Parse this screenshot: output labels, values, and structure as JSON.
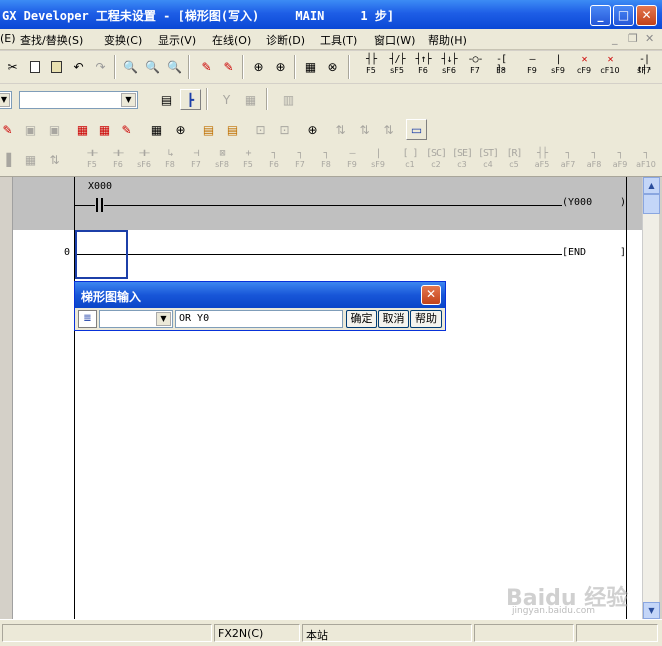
{
  "window": {
    "title": "GX Developer 工程未设置 - [梯形图(写入)     MAIN     1 步]",
    "minimize_glyph": "_",
    "maximize_glyph": "□",
    "close_glyph": "✕"
  },
  "menu": {
    "items": [
      "查找/替换(S)",
      "变换(C)",
      "显示(V)",
      "在线(O)",
      "诊断(D)",
      "工具(T)",
      "窗口(W)",
      "帮助(H)"
    ],
    "partial_first": "(E)",
    "mdi_min": "_",
    "mdi_restore": "❐",
    "mdi_close": "✕"
  },
  "fkeys_row1": [
    {
      "sym": "┤├",
      "label": "F5"
    },
    {
      "sym": "┤/├",
      "label": "sF5"
    },
    {
      "sym": "┤↑├",
      "label": "F6"
    },
    {
      "sym": "┤↓├",
      "label": "sF6"
    },
    {
      "sym": "-○-",
      "label": "F7"
    },
    {
      "sym": "-[ ]-",
      "label": "F8"
    },
    {
      "sym": "—",
      "label": "F9"
    },
    {
      "sym": "|",
      "label": "sF9"
    },
    {
      "sym": "✕",
      "label": "cF9"
    },
    {
      "sym": "✕",
      "label": "cF10"
    },
    {
      "sym": "-|↑|-",
      "label": "sF7"
    }
  ],
  "fkeys_row4": [
    {
      "sym": "⊣⊢",
      "label": "F5"
    },
    {
      "sym": "⊣⊢",
      "label": "F6"
    },
    {
      "sym": "⊣⊢",
      "label": "sF6"
    },
    {
      "sym": "↳",
      "label": "F8"
    },
    {
      "sym": "⊣",
      "label": "F7"
    },
    {
      "sym": "⊠",
      "label": "sF8"
    },
    {
      "sym": "+",
      "label": "F5"
    },
    {
      "sym": "┐",
      "label": "F6"
    },
    {
      "sym": "┐",
      "label": "F7"
    },
    {
      "sym": "┐",
      "label": "F8"
    },
    {
      "sym": "—",
      "label": "F9"
    },
    {
      "sym": "|",
      "label": "sF9"
    },
    {
      "sym": "[ ]",
      "label": "c1"
    },
    {
      "sym": "[SC]",
      "label": "c2"
    },
    {
      "sym": "[SE]",
      "label": "c3"
    },
    {
      "sym": "[ST]",
      "label": "c4"
    },
    {
      "sym": "[R]",
      "label": "c5"
    },
    {
      "sym": "┤├",
      "label": "aF5"
    },
    {
      "sym": "┐",
      "label": "aF7"
    },
    {
      "sym": "┐",
      "label": "aF8"
    },
    {
      "sym": "┐",
      "label": "aF9"
    },
    {
      "sym": "┐",
      "label": "aF10"
    }
  ],
  "ladder": {
    "rung1": {
      "contact": "X000",
      "coil": "(Y000",
      "coil_close": ")"
    },
    "rung2": {
      "step": "0",
      "end": "[END",
      "end_close": "]"
    }
  },
  "dialog": {
    "title": "梯形图输入",
    "icon": "≣",
    "input_value": "OR Y0",
    "ok_label": "确定",
    "cancel_label": "取消",
    "help_label": "帮助",
    "close_glyph": "✕"
  },
  "status": {
    "plc_type": "FX2N(C)",
    "station": "本站"
  },
  "watermark": {
    "text": "Baidu 经验",
    "sub": "jingyan.baidu.com"
  },
  "colors": {
    "title_blue": "#0a48d6",
    "gray_rung": "#c0c0c0",
    "cursor_blue": "#1c3fa8"
  }
}
